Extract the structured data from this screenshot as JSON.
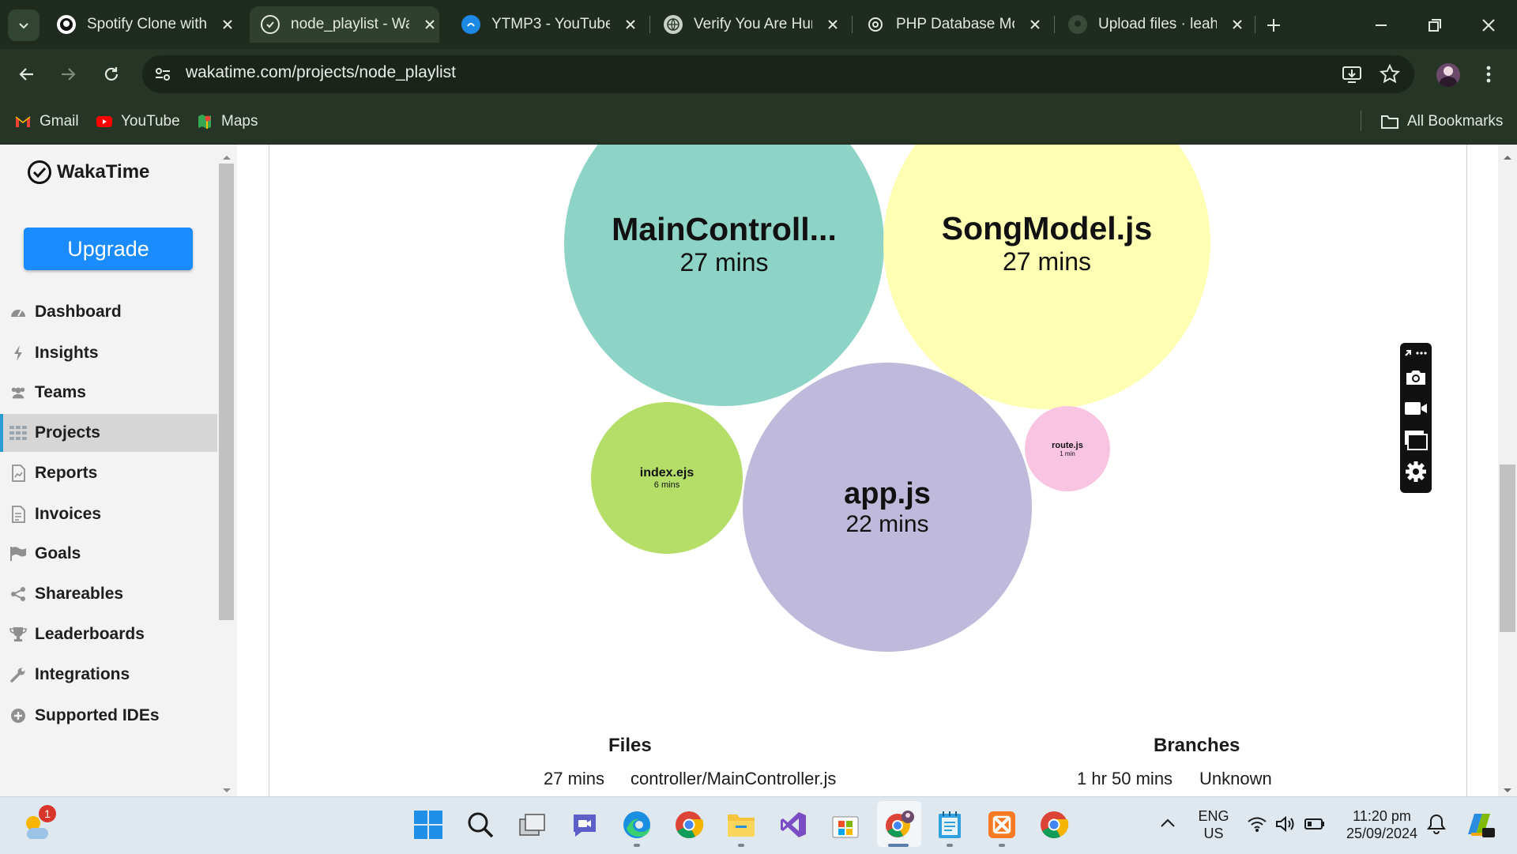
{
  "browser": {
    "tabs": [
      {
        "title": "Spotify Clone with",
        "icon": "github-icon"
      },
      {
        "title": "node_playlist - Wa",
        "icon": "wakatime-icon",
        "active": true
      },
      {
        "title": "YTMP3 - YouTube",
        "icon": "ytmp3-icon"
      },
      {
        "title": "Verify You Are Hun",
        "icon": "globe-icon"
      },
      {
        "title": "PHP Database Mo",
        "icon": "chatgpt-icon"
      },
      {
        "title": "Upload files · leahr",
        "icon": "github-icon"
      }
    ],
    "url": "wakatime.com/projects/node_playlist",
    "bookmarks": [
      {
        "label": "Gmail",
        "icon": "gmail-icon"
      },
      {
        "label": "YouTube",
        "icon": "youtube-icon"
      },
      {
        "label": "Maps",
        "icon": "maps-icon"
      }
    ],
    "all_bookmarks": "All Bookmarks"
  },
  "sidebar": {
    "logo": "WakaTime",
    "upgrade": "Upgrade",
    "items": [
      {
        "label": "Dashboard",
        "icon": "dashboard-icon"
      },
      {
        "label": "Insights",
        "icon": "bolt-icon"
      },
      {
        "label": "Teams",
        "icon": "users-icon"
      },
      {
        "label": "Projects",
        "icon": "grid-icon",
        "active": true
      },
      {
        "label": "Reports",
        "icon": "report-icon"
      },
      {
        "label": "Invoices",
        "icon": "invoice-icon"
      },
      {
        "label": "Goals",
        "icon": "flag-icon"
      },
      {
        "label": "Shareables",
        "icon": "share-icon"
      },
      {
        "label": "Leaderboards",
        "icon": "trophy-icon"
      },
      {
        "label": "Integrations",
        "icon": "wrench-icon"
      },
      {
        "label": "Supported IDEs",
        "icon": "plus-circle-icon"
      }
    ]
  },
  "bubbles": [
    {
      "name": "MainControll...",
      "time": "27 mins",
      "color": "#8ed4c6"
    },
    {
      "name": "SongModel.js",
      "time": "27 mins",
      "color": "#feffb3"
    },
    {
      "name": "app.js",
      "time": "22 mins",
      "color": "#bfbadb"
    },
    {
      "name": "index.ejs",
      "time": "6 mins",
      "color": "#b4de68"
    },
    {
      "name": "route.js",
      "time": "1 min",
      "color": "#f9c4e2"
    }
  ],
  "files": {
    "title": "Files",
    "rows": [
      {
        "time": "27 mins",
        "name": "controller/MainController.js"
      }
    ]
  },
  "branches": {
    "title": "Branches",
    "rows": [
      {
        "time": "1 hr 50 mins",
        "name": "Unknown"
      }
    ]
  },
  "taskbar": {
    "weather_badge": "1",
    "lang_line1": "ENG",
    "lang_line2": "US",
    "time": "11:20 pm",
    "date": "25/09/2024"
  }
}
